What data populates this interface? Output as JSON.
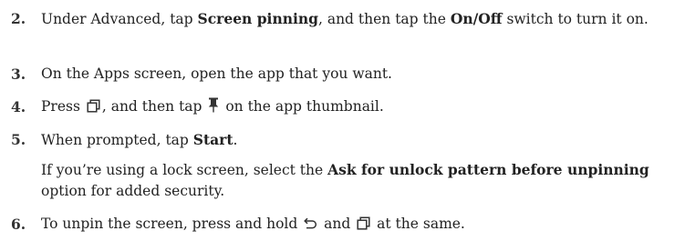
{
  "steps": [
    {
      "number": "2.",
      "parts": {
        "a": "Under Advanced, tap ",
        "b": "Screen pinning",
        "c": ", and then tap the ",
        "d": "On/Off",
        "e": " switch to turn it on."
      }
    },
    {
      "number": "3.",
      "text": "On the Apps screen, open the app that you want."
    },
    {
      "number": "4.",
      "parts": {
        "a": "Press ",
        "b": ", and then tap ",
        "c": " on the app thumbnail."
      },
      "icons": [
        "recent-apps-icon",
        "pin-icon"
      ]
    },
    {
      "number": "5.",
      "parts": {
        "a": "When prompted, tap ",
        "b": "Start",
        "c": "."
      },
      "note": {
        "a": "If you’re using a lock screen, select the ",
        "b": "Ask for unlock pattern before unpinning",
        "c": " option for added security."
      }
    },
    {
      "number": "6.",
      "parts": {
        "a": "To unpin the screen, press and hold ",
        "b": " and ",
        "c": " at the same."
      },
      "icons": [
        "back-icon",
        "recent-apps-icon"
      ]
    }
  ]
}
